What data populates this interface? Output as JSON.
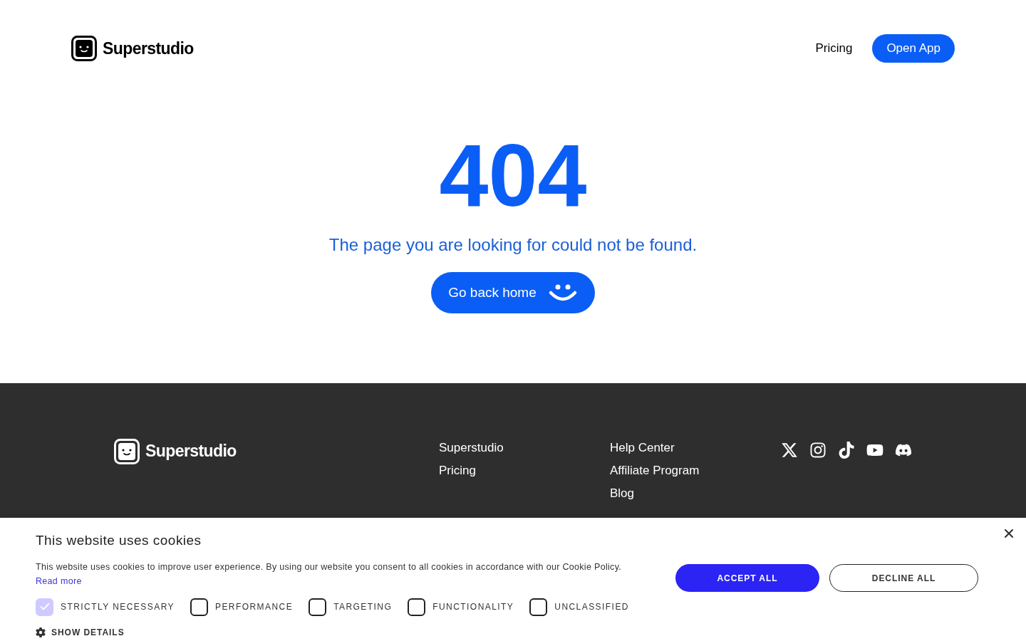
{
  "header": {
    "brand": "Superstudio",
    "nav": [
      "Pricing"
    ],
    "cta": "Open App"
  },
  "error": {
    "code": "404",
    "message": "The page you are looking for could not be found.",
    "button": "Go back home"
  },
  "footer": {
    "brand": "Superstudio",
    "columns": [
      [
        "Superstudio",
        "Pricing"
      ],
      [
        "Help Center",
        "Affiliate Program",
        "Blog"
      ]
    ],
    "socials": [
      {
        "kind": "x"
      },
      {
        "kind": "instagram"
      },
      {
        "kind": "tiktok"
      },
      {
        "kind": "youtube"
      },
      {
        "kind": "discord"
      }
    ]
  },
  "cookie_banner": {
    "title": "This website uses cookies",
    "text": "This website uses cookies to improve user experience. By using our website you consent to all cookies in accordance with our Cookie Policy.",
    "link": "Read more",
    "categories": [
      {
        "label": "STRICTLY NECESSARY",
        "checked": true
      },
      {
        "label": "PERFORMANCE",
        "checked": false
      },
      {
        "label": "TARGETING",
        "checked": false
      },
      {
        "label": "FUNCTIONALITY",
        "checked": false
      },
      {
        "label": "UNCLASSIFIED",
        "checked": false
      }
    ],
    "details": "SHOW DETAILS",
    "accept": "ACCEPT ALL",
    "decline": "DECLINE ALL"
  }
}
